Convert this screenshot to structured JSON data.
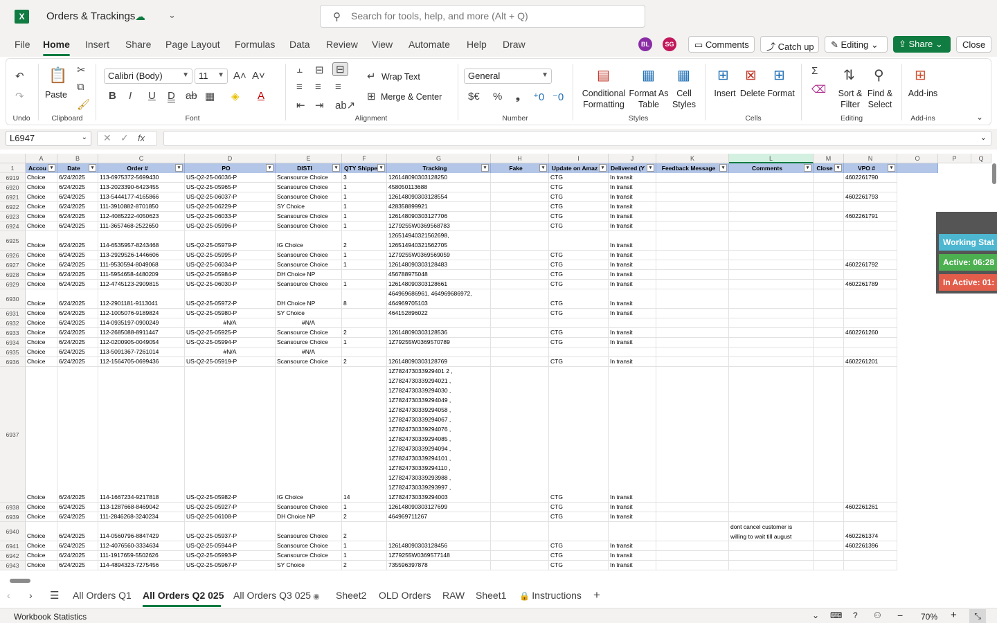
{
  "app": {
    "title": "Orders & Trackings",
    "search_placeholder": "Search for tools, help, and more (Alt + Q)"
  },
  "menu": {
    "items": [
      "File",
      "Home",
      "Insert",
      "Share",
      "Page Layout",
      "Formulas",
      "Data",
      "Review",
      "View",
      "Automate",
      "Help",
      "Draw"
    ],
    "active": "Home"
  },
  "avatars": [
    {
      "initials": "BL",
      "color": "#8a2da5"
    },
    {
      "initials": "SG",
      "color": "#c2185b"
    }
  ],
  "actions": {
    "comments": "Comments",
    "catchup": "Catch up",
    "editing": "Editing",
    "share": "Share",
    "close": "Close"
  },
  "ribbon": {
    "undo_label": "Undo",
    "clipboard_label": "Clipboard",
    "paste": "Paste",
    "font_name": "Calibri (Body)",
    "font_size": "11",
    "font_label": "Font",
    "wrap_text": "Wrap Text",
    "merge_center": "Merge & Center",
    "alignment_label": "Alignment",
    "number_format": "General",
    "number_label": "Number",
    "cond_format": "Conditional Formatting",
    "format_table": "Format As Table",
    "cell_styles": "Cell Styles",
    "styles_label": "Styles",
    "insert": "Insert",
    "delete": "Delete",
    "format": "Format",
    "cells_label": "Cells",
    "sort_filter": "Sort & Filter",
    "find_select": "Find & Select",
    "editing_label": "Editing",
    "addins": "Add-ins",
    "addins_label": "Add-ins"
  },
  "formula": {
    "name_box": "L6947",
    "fx": "fx",
    "value": ""
  },
  "columns": [
    "A",
    "B",
    "C",
    "D",
    "E",
    "F",
    "G",
    "H",
    "I",
    "J",
    "K",
    "L",
    "M",
    "N",
    "O",
    "P",
    "Q"
  ],
  "headers": [
    "Accou",
    "Date",
    "Order #",
    "PO",
    "DISTI",
    "QTY Shippe",
    "Tracking",
    "Fake",
    "Update on Amaz",
    "Delivered (Y",
    "Feedback Message",
    "Comments",
    "Close",
    "VPO #",
    ""
  ],
  "rows": [
    {
      "n": "6919",
      "a": "Choice",
      "b": "6/24/2025",
      "c": "113-6975372-5699430",
      "d": "US-Q2-25-06036-P",
      "e": "Scansource Choice",
      "f": "3",
      "g": "126148090303128250",
      "i": "CTG",
      "j": "In transit",
      "l": "",
      "n2": "4602261790"
    },
    {
      "n": "6920",
      "a": "Choice",
      "b": "6/24/2025",
      "c": "113-2023390-6423455",
      "d": "US-Q2-25-05965-P",
      "e": "Scansource Choice",
      "f": "1",
      "g": "458050113688",
      "i": "CTG",
      "j": "In transit",
      "l": "",
      "n2": ""
    },
    {
      "n": "6921",
      "a": "Choice",
      "b": "6/24/2025",
      "c": "113-5444177-4165866",
      "d": "US-Q2-25-06037-P",
      "e": "Scansource Choice",
      "f": "1",
      "g": "126148090303128554",
      "i": "CTG",
      "j": "In transit",
      "l": "",
      "n2": "4602261793"
    },
    {
      "n": "6922",
      "a": "Choice",
      "b": "6/24/2025",
      "c": "111-3910882-8701850",
      "d": "US-Q2-25-06229-P",
      "e": "SY Choice",
      "f": "1",
      "g": "428358899921",
      "i": "CTG",
      "j": "In transit",
      "l": "",
      "n2": ""
    },
    {
      "n": "6923",
      "a": "Choice",
      "b": "6/24/2025",
      "c": "112-4085222-4050623",
      "d": "US-Q2-25-06033-P",
      "e": "Scansource Choice",
      "f": "1",
      "g": "126148090303127706",
      "i": "CTG",
      "j": "In transit",
      "l": "",
      "n2": "4602261791"
    },
    {
      "n": "6924",
      "a": "Choice",
      "b": "6/24/2025",
      "c": "111-3657468-2522650",
      "d": "US-Q2-25-05996-P",
      "e": "Scansource Choice",
      "f": "1",
      "g": "1Z79255W0369568783",
      "i": "CTG",
      "j": "In transit",
      "l": "",
      "n2": ""
    },
    {
      "n": "6925",
      "a": "Choice",
      "b": "6/24/2025",
      "c": "114-6535957-8243468",
      "d": "US-Q2-25-05979-P",
      "e": "IG Choice",
      "f": "2",
      "g": "126514940321562698,\n126514940321562705",
      "i": "",
      "j": "In transit",
      "l": "",
      "n2": ""
    },
    {
      "n": "6926",
      "a": "Choice",
      "b": "6/24/2025",
      "c": "113-2929526-1446606",
      "d": "US-Q2-25-05995-P",
      "e": "Scansource Choice",
      "f": "1",
      "g": "1Z79255W0369569059",
      "i": "CTG",
      "j": "In transit",
      "l": "",
      "n2": ""
    },
    {
      "n": "6927",
      "a": "Choice",
      "b": "6/24/2025",
      "c": "111-9530594-8049068",
      "d": "US-Q2-25-06034-P",
      "e": "Scansource Choice",
      "f": "1",
      "g": "126148090303128483",
      "i": "CTG",
      "j": "In transit",
      "l": "",
      "n2": "4602261792"
    },
    {
      "n": "6928",
      "a": "Choice",
      "b": "6/24/2025",
      "c": "111-5954658-4480209",
      "d": "US-Q2-25-05984-P",
      "e": "DH Choice NP",
      "f": "",
      "g": "456788975048",
      "i": "CTG",
      "j": "In transit",
      "l": "",
      "n2": ""
    },
    {
      "n": "6929",
      "a": "Choice",
      "b": "6/24/2025",
      "c": "112-4745123-2909815",
      "d": "US-Q2-25-06030-P",
      "e": "Scansource Choice",
      "f": "1",
      "g": "126148090303128661",
      "i": "CTG",
      "j": "In transit",
      "l": "",
      "n2": "4602261789"
    },
    {
      "n": "6930",
      "a": "Choice",
      "b": "6/24/2025",
      "c": "112-2901181-9113041",
      "d": "US-Q2-25-05972-P",
      "e": "DH Choice NP",
      "f": "8",
      "g": "464969686961, 464969686972,\n464969705103",
      "i": "CTG",
      "j": "In transit",
      "l": "",
      "n2": ""
    },
    {
      "n": "6931",
      "a": "Choice",
      "b": "6/24/2025",
      "c": "112-1005076-9189824",
      "d": "US-Q2-25-05980-P",
      "e": "SY Choice",
      "f": "",
      "g": "464152896022",
      "i": "CTG",
      "j": "In transit",
      "l": "",
      "n2": ""
    },
    {
      "n": "6932",
      "a": "Choice",
      "b": "6/24/2025",
      "c": "114-0935197-0900249",
      "d": "#N/A",
      "e": "#N/A",
      "f": "",
      "g": "",
      "i": "",
      "j": "",
      "l": "",
      "n2": ""
    },
    {
      "n": "6933",
      "a": "Choice",
      "b": "6/24/2025",
      "c": "112-2685088-8911447",
      "d": "US-Q2-25-05925-P",
      "e": "Scansource Choice",
      "f": "2",
      "g": "126148090303128536",
      "i": "CTG",
      "j": "In transit",
      "l": "",
      "n2": "4602261260"
    },
    {
      "n": "6934",
      "a": "Choice",
      "b": "6/24/2025",
      "c": "112-0200905-0049054",
      "d": "US-Q2-25-05994-P",
      "e": "Scansource Choice",
      "f": "1",
      "g": "1Z79255W0369570789",
      "i": "CTG",
      "j": "In transit",
      "l": "",
      "n2": ""
    },
    {
      "n": "6935",
      "a": "Choice",
      "b": "6/24/2025",
      "c": "113-5091367-7261014",
      "d": "#N/A",
      "e": "#N/A",
      "f": "",
      "g": "",
      "i": "",
      "j": "",
      "l": "",
      "n2": ""
    },
    {
      "n": "6936",
      "a": "Choice",
      "b": "6/24/2025",
      "c": "112-1564705-0699436",
      "d": "US-Q2-25-05919-P",
      "e": "Scansource Choice",
      "f": "2",
      "g": "126148090303128769",
      "i": "CTG",
      "j": "In transit",
      "l": "",
      "n2": "4602261201"
    },
    {
      "n": "6937",
      "a": "Choice",
      "b": "6/24/2025",
      "c": "114-1667234-9217818",
      "d": "US-Q2-25-05982-P",
      "e": "IG Choice",
      "f": "14",
      "g": "1Z782473033929401 2 ,\n1Z7824730339294021 ,\n1Z7824730339294030 ,\n1Z7824730339294049 ,\n1Z7824730339294058 ,\n1Z7824730339294067 ,\n1Z7824730339294076 ,\n1Z7824730339294085 ,\n1Z7824730339294094 ,\n1Z7824730339294101 ,\n1Z7824730339294110 ,\n1Z7824730339293988 ,\n1Z7824730339293997 ,\n1Z7824730339294003",
      "i": "CTG",
      "j": "In transit",
      "l": "",
      "n2": ""
    },
    {
      "n": "6938",
      "a": "Choice",
      "b": "6/24/2025",
      "c": "113-1287668-8469042",
      "d": "US-Q2-25-05927-P",
      "e": "Scansource Choice",
      "f": "1",
      "g": "126148090303127699",
      "i": "CTG",
      "j": "In transit",
      "l": "",
      "n2": "4602261261"
    },
    {
      "n": "6939",
      "a": "Choice",
      "b": "6/24/2025",
      "c": "111-2846268-3240234",
      "d": "US-Q2-25-06108-P",
      "e": "DH Choice NP",
      "f": "2",
      "g": "464969711267",
      "i": "CTG",
      "j": "In transit",
      "l": "",
      "n2": ""
    },
    {
      "n": "6940",
      "a": "Choice",
      "b": "6/24/2025",
      "c": "114-0560796-8847429",
      "d": "US-Q2-25-05937-P",
      "e": "Scansource Choice",
      "f": "2",
      "g": "",
      "i": "",
      "j": "",
      "l": "dont cancel customer is\nwilling to wait till august",
      "n2": "4602261374"
    },
    {
      "n": "6941",
      "a": "Choice",
      "b": "6/24/2025",
      "c": "112-4076560-3334634",
      "d": "US-Q2-25-05944-P",
      "e": "Scansource Choice",
      "f": "1",
      "g": "126148090303128456",
      "i": "CTG",
      "j": "In transit",
      "l": "",
      "n2": "4602261396"
    },
    {
      "n": "6942",
      "a": "Choice",
      "b": "6/24/2025",
      "c": "111-1917659-5502626",
      "d": "US-Q2-25-05993-P",
      "e": "Scansource Choice",
      "f": "1",
      "g": "1Z79255W0369577148",
      "i": "CTG",
      "j": "In transit",
      "l": "",
      "n2": ""
    },
    {
      "n": "6943",
      "a": "Choice",
      "b": "6/24/2025",
      "c": "114-4894323-7275456",
      "d": "US-Q2-25-05967-P",
      "e": "SY Choice",
      "f": "2",
      "g": "735596397878",
      "i": "CTG",
      "j": "In transit",
      "l": "",
      "n2": ""
    }
  ],
  "overlay": {
    "working": "Working Stat",
    "active": "Active: 06:28",
    "inactive": "In Active: 01:"
  },
  "sheets": [
    "All Orders Q1",
    "All Orders Q2 025",
    "All Orders Q3 025",
    "Sheet2",
    "OLD Orders",
    "RAW",
    "Sheet1",
    "Instructions"
  ],
  "active_sheet": "All Orders Q2 025",
  "status": {
    "left": "Workbook Statistics",
    "zoom": "70%"
  }
}
